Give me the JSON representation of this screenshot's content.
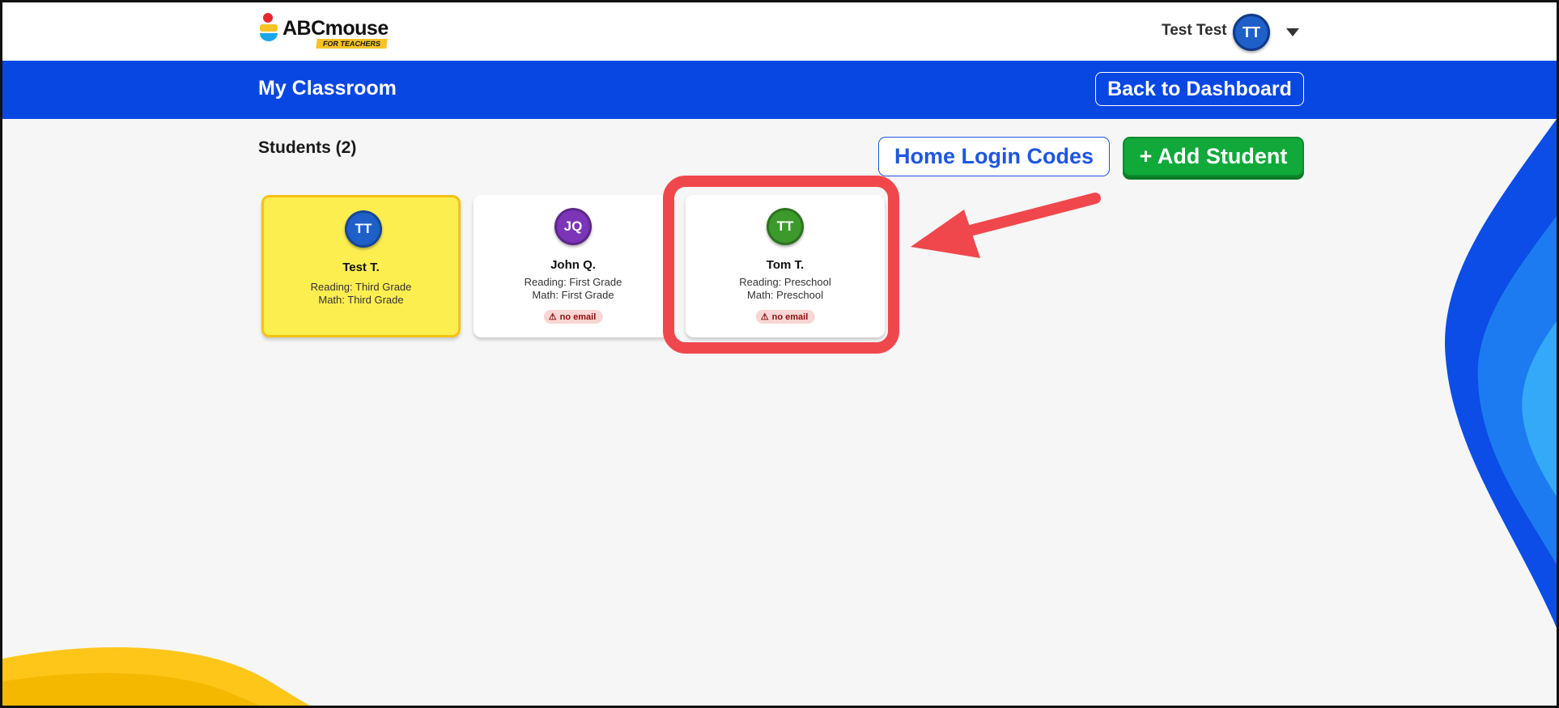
{
  "header": {
    "logo": {
      "word": "ABCmouse",
      "sub": "FOR TEACHERS"
    },
    "user": {
      "name": "Test Test",
      "initials": "TT"
    }
  },
  "titlebar": {
    "title": "My Classroom",
    "back_label": "Back to Dashboard"
  },
  "students": {
    "heading": "Students (2)",
    "home_codes_label": "Home Login Codes",
    "add_label": "+ Add Student",
    "cards": [
      {
        "initials": "TT",
        "name": "Test T.",
        "reading": "Reading: Third Grade",
        "math": "Math: Third Grade",
        "badge": "",
        "avatar_color": "#1f5fc9",
        "selected": true
      },
      {
        "initials": "JQ",
        "name": "John Q.",
        "reading": "Reading: First Grade",
        "math": "Math: First Grade",
        "badge": "no email",
        "avatar_color": "#7c35b7",
        "selected": false
      },
      {
        "initials": "TT",
        "name": "Tom T.",
        "reading": "Reading: Preschool",
        "math": "Math: Preschool",
        "badge": "no email",
        "avatar_color": "#3c9a2c",
        "selected": false
      }
    ]
  },
  "colors": {
    "brand_blue": "#0847e2",
    "add_green": "#10a93a",
    "annotation_red": "#f0474d",
    "warning_text": "#8b1010"
  },
  "icons": [
    "caret-down-icon",
    "warning-icon",
    "annotation-arrow"
  ]
}
